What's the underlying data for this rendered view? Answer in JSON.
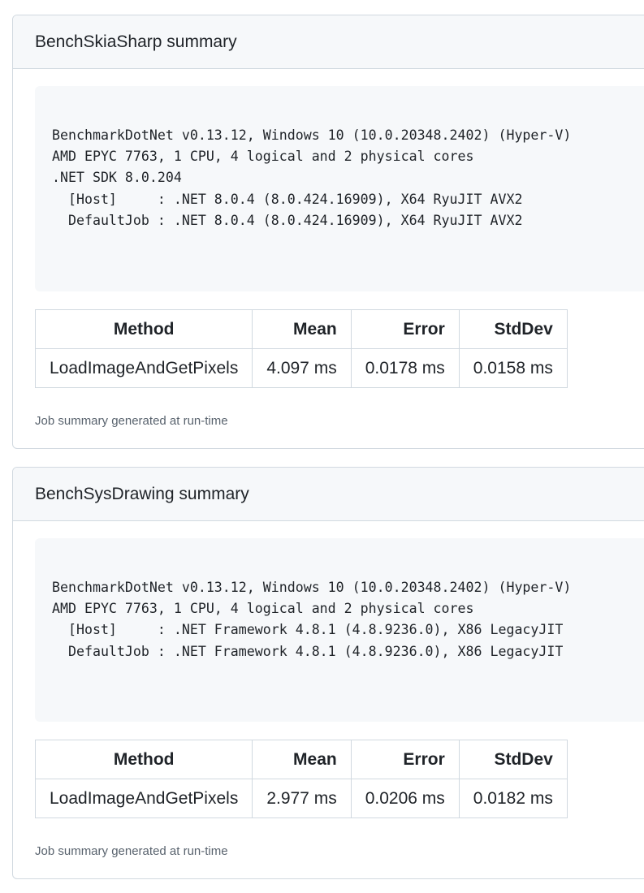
{
  "summaries": [
    {
      "title": "BenchSkiaSharp summary",
      "environment_lines": [
        "BenchmarkDotNet v0.13.12, Windows 10 (10.0.20348.2402) (Hyper-V)",
        "AMD EPYC 7763, 1 CPU, 4 logical and 2 physical cores",
        ".NET SDK 8.0.204",
        "  [Host]     : .NET 8.0.4 (8.0.424.16909), X64 RyuJIT AVX2",
        "  DefaultJob : .NET 8.0.4 (8.0.424.16909), X64 RyuJIT AVX2"
      ],
      "table": {
        "headers": [
          "Method",
          "Mean",
          "Error",
          "StdDev"
        ],
        "rows": [
          [
            "LoadImageAndGetPixels",
            "4.097 ms",
            "0.0178 ms",
            "0.0158 ms"
          ]
        ]
      },
      "footnote": "Job summary generated at run-time"
    },
    {
      "title": "BenchSysDrawing summary",
      "environment_lines": [
        "BenchmarkDotNet v0.13.12, Windows 10 (10.0.20348.2402) (Hyper-V)",
        "AMD EPYC 7763, 1 CPU, 4 logical and 2 physical cores",
        "  [Host]     : .NET Framework 4.8.1 (4.8.9236.0), X86 LegacyJIT",
        "  DefaultJob : .NET Framework 4.8.1 (4.8.9236.0), X86 LegacyJIT"
      ],
      "table": {
        "headers": [
          "Method",
          "Mean",
          "Error",
          "StdDev"
        ],
        "rows": [
          [
            "LoadImageAndGetPixels",
            "2.977 ms",
            "0.0206 ms",
            "0.0182 ms"
          ]
        ]
      },
      "footnote": "Job summary generated at run-time"
    }
  ]
}
